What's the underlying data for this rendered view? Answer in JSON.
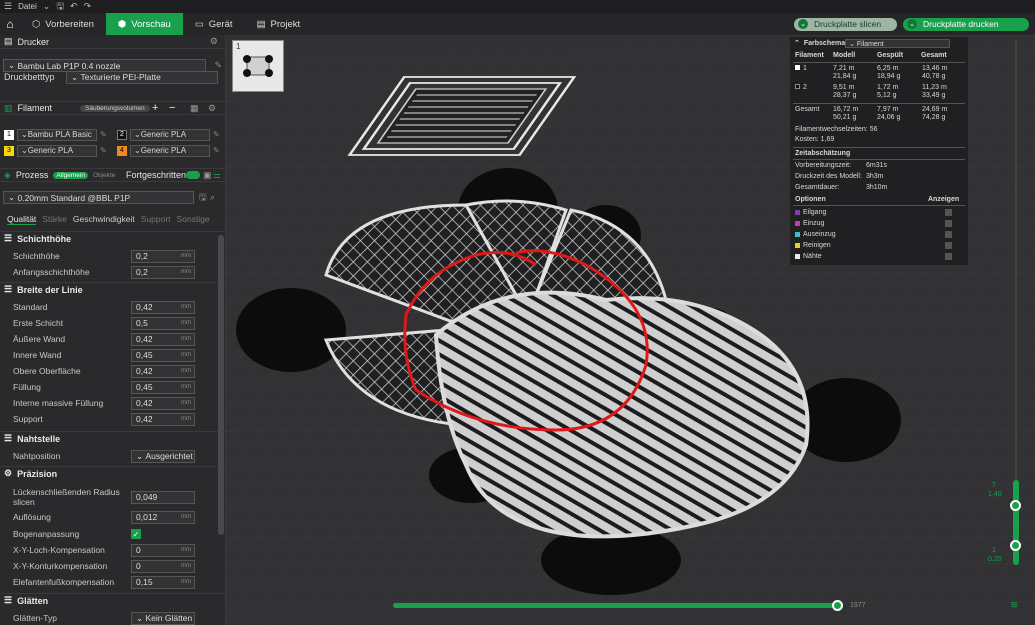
{
  "menubar": {
    "file": "Datei"
  },
  "nav": {
    "tabs": [
      "Vorbereiten",
      "Vorschau",
      "Gerät",
      "Projekt"
    ],
    "slice_button": "Druckplatte slicen",
    "print_button": "Druckplatte drucken"
  },
  "printer": {
    "section": "Drucker",
    "name": "Bambu Lab P1P 0.4 nozzle",
    "bed_label": "Druckbetttyp",
    "bed_value": "Texturierte PEI-Platte"
  },
  "filament": {
    "section": "Filament",
    "flush_button": "Säuberungsvolumen",
    "items": [
      {
        "num": "1",
        "name": "Bambu PLA Basic",
        "color": "#ffffff"
      },
      {
        "num": "2",
        "name": "Generic PLA",
        "color": "#111111"
      },
      {
        "num": "3",
        "name": "Generic PLA",
        "color": "#f5d90a"
      },
      {
        "num": "4",
        "name": "Generic PLA",
        "color": "#f08a1c"
      }
    ]
  },
  "process": {
    "section": "Prozess",
    "toggle_on": "Allgemein",
    "toggle_off": "Objekte",
    "advanced": "Fortgeschritten",
    "profile": "0.20mm Standard @BBL P1P",
    "tabs": [
      "Qualität",
      "Stärke",
      "Geschwindigkeit",
      "Support",
      "Sonstige"
    ]
  },
  "params": {
    "layer_height": {
      "title": "Schichthöhe",
      "rows": [
        {
          "label": "Schichthöhe",
          "value": "0,2",
          "unit": "mm"
        },
        {
          "label": "Anfangsschichthöhe",
          "value": "0,2",
          "unit": "mm"
        }
      ]
    },
    "line_width": {
      "title": "Breite der Linie",
      "rows": [
        {
          "label": "Standard",
          "value": "0,42",
          "unit": "mm"
        },
        {
          "label": "Erste Schicht",
          "value": "0,5",
          "unit": "mm"
        },
        {
          "label": "Äußere Wand",
          "value": "0,42",
          "unit": "mm"
        },
        {
          "label": "Innere Wand",
          "value": "0,45",
          "unit": "mm"
        },
        {
          "label": "Obere Oberfläche",
          "value": "0,42",
          "unit": "mm"
        },
        {
          "label": "Füllung",
          "value": "0,45",
          "unit": "mm"
        },
        {
          "label": "Interne massive Füllung",
          "value": "0,42",
          "unit": "mm"
        },
        {
          "label": "Support",
          "value": "0,42",
          "unit": "mm"
        }
      ]
    },
    "seam": {
      "title": "Nahtstelle",
      "label": "Nahtposition",
      "value": "Ausgerichtet"
    },
    "precision": {
      "title": "Präzision",
      "rows": [
        {
          "label": "Lückenschließenden Radius slicen",
          "value": "0,049",
          "unit": ""
        },
        {
          "label": "Auflösung",
          "value": "0,012",
          "unit": "mm"
        },
        {
          "label": "Bogenanpassung",
          "value": "",
          "unit": ""
        },
        {
          "label": "X-Y-Loch-Kompensation",
          "value": "0",
          "unit": "mm"
        },
        {
          "label": "X-Y-Konturkompensation",
          "value": "0",
          "unit": "mm"
        },
        {
          "label": "Elefantenfußkompensation",
          "value": "0,15",
          "unit": "mm"
        }
      ]
    },
    "ironing": {
      "title": "Glätten",
      "label": "Glätten-Typ",
      "value": "Kein Glätten"
    }
  },
  "stats": {
    "scheme_label": "Farbschema",
    "scheme_value": "Filament",
    "columns": [
      "Filament",
      "Modell",
      "Gespült",
      "Gesamt"
    ],
    "rows": [
      {
        "id": "1",
        "color": "#ffffff",
        "modell": [
          "7,21 m",
          "21,84 g"
        ],
        "gespuelt": [
          "6,25 m",
          "18,94 g"
        ],
        "gesamt": [
          "13,46 m",
          "40,78 g"
        ]
      },
      {
        "id": "2",
        "color": "#111111",
        "modell": [
          "9,51 m",
          "28,37 g"
        ],
        "gespuelt": [
          "1,72 m",
          "5,12 g"
        ],
        "gesamt": [
          "11,23 m",
          "33,49 g"
        ]
      }
    ],
    "total": {
      "label": "Gesamt",
      "modell": [
        "16,72 m",
        "50,21 g"
      ],
      "gespuelt": [
        "7,97 m",
        "24,06 g"
      ],
      "gesamt": [
        "24,69 m",
        "74,28 g"
      ]
    },
    "changes": "Filamentwechselzeiten:  56",
    "cost": "Kosten:  1,69",
    "time_title": "Zeitabschätzung",
    "prep_label": "Vorbereitungszeit:",
    "prep_value": "6m31s",
    "model_label": "Druckzeit des Modell:",
    "model_value": "3h3m",
    "total_label": "Gesamtdauer:",
    "total_value": "3h10m",
    "options_label": "Optionen",
    "show_label": "Anzeigen",
    "options": [
      {
        "name": "Eilgang",
        "color": "#7a3fb0"
      },
      {
        "name": "Einzug",
        "color": "#c03cc0"
      },
      {
        "name": "Auseinzug",
        "color": "#3fc0c0"
      },
      {
        "name": "Reinigen",
        "color": "#e8d020"
      },
      {
        "name": "Nähte",
        "color": "#e8e8e8"
      }
    ]
  },
  "layer_slider": {
    "top_layer": "7",
    "top_height": "1,40",
    "bottom_layer": "1",
    "bottom_height": "0,20"
  },
  "move_slider": {
    "value": "1977"
  },
  "thumbnail": {
    "plate": "1"
  }
}
